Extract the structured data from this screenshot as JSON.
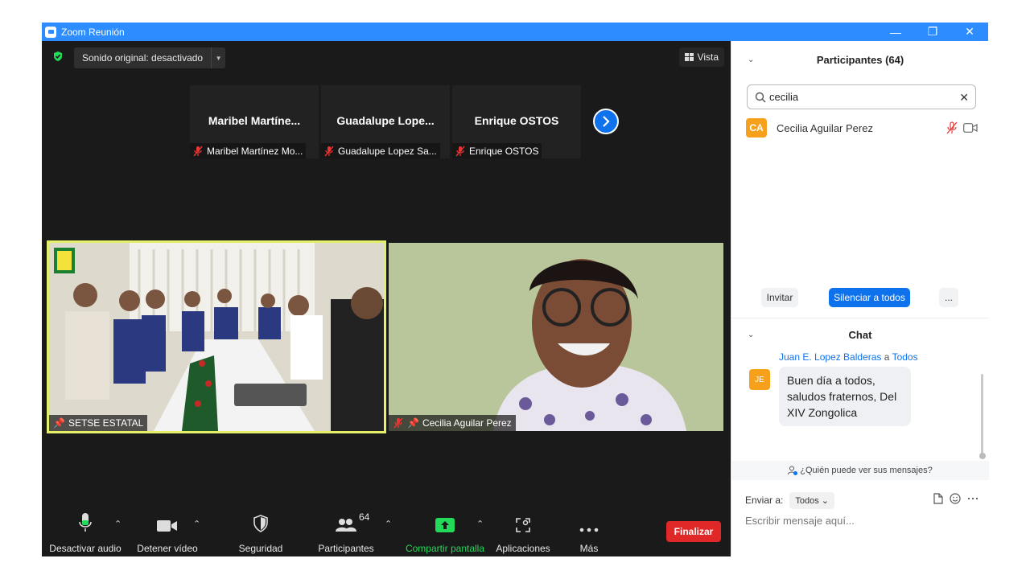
{
  "window": {
    "title": "Zoom Reunión",
    "controls": {
      "minimize": "—",
      "restore": "❐",
      "close": "✕"
    }
  },
  "meeting": {
    "sound_label": "Sonido original: desactivado",
    "view_label": "Vista",
    "thumbnails": [
      {
        "name": "Maribel  Martíne...",
        "label": "Maribel Martínez Mo..."
      },
      {
        "name": "Guadalupe  Lope...",
        "label": "Guadalupe Lopez Sa..."
      },
      {
        "name": "Enrique OSTOS",
        "label": "Enrique OSTOS"
      }
    ],
    "tiles": [
      {
        "label": "SETSE ESTATAL"
      },
      {
        "label": "Cecilia Aguilar Perez"
      }
    ]
  },
  "toolbar": {
    "audio": "Desactivar audio",
    "video": "Detener vídeo",
    "security": "Seguridad",
    "participants": "Participantes",
    "participants_count": "64",
    "share": "Compartir pantalla",
    "apps": "Aplicaciones",
    "more": "Más",
    "end": "Finalizar"
  },
  "participants_panel": {
    "title": "Participantes (64)",
    "search_value": "cecilia",
    "list": [
      {
        "initials": "CA",
        "name": "Cecilia Aguilar Perez"
      }
    ],
    "invite": "Invitar",
    "mute_all": "Silenciar a todos",
    "more": "..."
  },
  "chat": {
    "title": "Chat",
    "message": {
      "sender": "Juan E. Lopez Balderas",
      "to_word": "a",
      "to": "Todos",
      "initials": "JE",
      "text": "Buen día a todos, saludos fraternos, Del XIV Zongolica"
    },
    "who_can_see": "¿Quién puede ver sus mensajes?",
    "send_to_label": "Enviar a:",
    "send_to_value": "Todos",
    "placeholder": "Escribir mensaje aquí..."
  },
  "colors": {
    "accent": "#0e72ed",
    "titlebar": "#2d8cff",
    "end_button": "#e02828",
    "share_green": "#23d959",
    "avatar_orange": "#f7a01c",
    "active_speaker": "#e4f06a"
  }
}
